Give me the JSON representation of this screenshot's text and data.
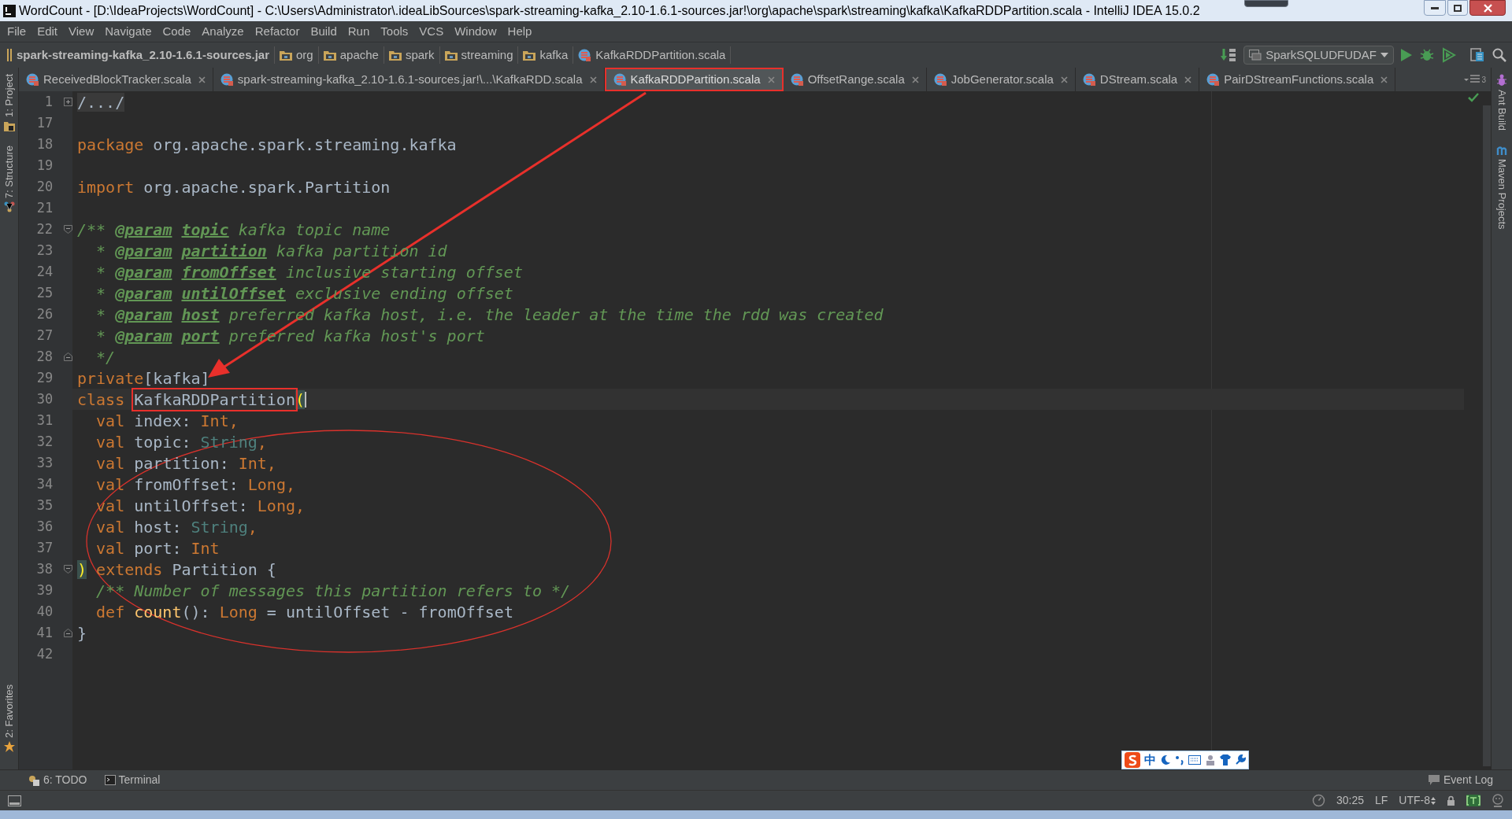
{
  "window": {
    "title": "WordCount - [D:\\IdeaProjects\\WordCount] - C:\\Users\\Administrator\\.ideaLibSources\\spark-streaming-kafka_2.10-1.6.1-sources.jar!\\org\\apache\\spark\\streaming\\kafka\\KafkaRDDPartition.scala - IntelliJ IDEA 15.0.2"
  },
  "menu": [
    "File",
    "Edit",
    "View",
    "Navigate",
    "Code",
    "Analyze",
    "Refactor",
    "Build",
    "Run",
    "Tools",
    "VCS",
    "Window",
    "Help"
  ],
  "breadcrumbs": [
    {
      "label": "spark-streaming-kafka_2.10-1.6.1-sources.jar",
      "kind": "jar"
    },
    {
      "label": "org",
      "kind": "folder"
    },
    {
      "label": "apache",
      "kind": "folder"
    },
    {
      "label": "spark",
      "kind": "folder"
    },
    {
      "label": "streaming",
      "kind": "folder"
    },
    {
      "label": "kafka",
      "kind": "folder"
    },
    {
      "label": "KafkaRDDPartition.scala",
      "kind": "file"
    }
  ],
  "run_config": "SparkSQLUDFUDAF",
  "tabs": [
    {
      "label": "ReceivedBlockTracker.scala",
      "selected": false,
      "highlighted": false
    },
    {
      "label": "spark-streaming-kafka_2.10-1.6.1-sources.jar!\\...\\KafkaRDD.scala",
      "selected": false,
      "highlighted": false
    },
    {
      "label": "KafkaRDDPartition.scala",
      "selected": true,
      "highlighted": true
    },
    {
      "label": "OffsetRange.scala",
      "selected": false,
      "highlighted": false
    },
    {
      "label": "JobGenerator.scala",
      "selected": false,
      "highlighted": false
    },
    {
      "label": "DStream.scala",
      "selected": false,
      "highlighted": false
    },
    {
      "label": "PairDStreamFunctions.scala",
      "selected": false,
      "highlighted": false
    }
  ],
  "tab_overflow": "3",
  "left_tool_windows_top": [
    "1: Project",
    "7: Structure"
  ],
  "left_tool_windows_bottom": [
    "2: Favorites"
  ],
  "right_tool_windows": [
    "Ant Build",
    "Maven Projects"
  ],
  "code_lines": [
    {
      "number": "1",
      "collapsed": true,
      "tokens": [
        {
          "kind": "folded",
          "text": "/.../"
        }
      ]
    },
    {
      "number": "17"
    },
    {
      "number": "18",
      "tokens": [
        {
          "kind": "keyword",
          "text": "package"
        },
        {
          "kind": "plain",
          "text": " org.apache.spark.streaming.kafka"
        }
      ]
    },
    {
      "number": "19"
    },
    {
      "number": "20",
      "tokens": [
        {
          "kind": "keyword",
          "text": "import"
        },
        {
          "kind": "plain",
          "text": " org.apache.spark.Partition"
        }
      ]
    },
    {
      "number": "21"
    },
    {
      "number": "22",
      "fold_start": true,
      "tokens": [
        {
          "kind": "doc",
          "text": "/** "
        },
        {
          "kind": "doc_tag",
          "text": "@param"
        },
        {
          "kind": "doc_param",
          "text": "topic"
        },
        {
          "kind": "doc",
          "text": " kafka topic name"
        }
      ]
    },
    {
      "number": "23",
      "tokens": [
        {
          "kind": "doc",
          "text": "  * "
        },
        {
          "kind": "doc_tag",
          "text": "@param"
        },
        {
          "kind": "doc_param",
          "text": "partition"
        },
        {
          "kind": "doc",
          "text": " kafka partition id"
        }
      ]
    },
    {
      "number": "24",
      "tokens": [
        {
          "kind": "doc",
          "text": "  * "
        },
        {
          "kind": "doc_tag",
          "text": "@param"
        },
        {
          "kind": "doc_param",
          "text": "fromOffset"
        },
        {
          "kind": "doc",
          "text": " inclusive starting offset"
        }
      ]
    },
    {
      "number": "25",
      "tokens": [
        {
          "kind": "doc",
          "text": "  * "
        },
        {
          "kind": "doc_tag",
          "text": "@param"
        },
        {
          "kind": "doc_param",
          "text": "untilOffset"
        },
        {
          "kind": "doc",
          "text": " exclusive ending offset"
        }
      ]
    },
    {
      "number": "26",
      "tokens": [
        {
          "kind": "doc",
          "text": "  * "
        },
        {
          "kind": "doc_tag",
          "text": "@param"
        },
        {
          "kind": "doc_param",
          "text": "host"
        },
        {
          "kind": "doc",
          "text": " preferred kafka host, i.e. the leader at the time the rdd was created"
        }
      ]
    },
    {
      "number": "27",
      "tokens": [
        {
          "kind": "doc",
          "text": "  * "
        },
        {
          "kind": "doc_tag",
          "text": "@param"
        },
        {
          "kind": "doc_param",
          "text": "port"
        },
        {
          "kind": "doc",
          "text": " preferred kafka host's port"
        }
      ]
    },
    {
      "number": "28",
      "fold_end": true,
      "tokens": [
        {
          "kind": "doc",
          "text": "  */"
        }
      ]
    },
    {
      "number": "29",
      "tokens": [
        {
          "kind": "keyword",
          "text": "private"
        },
        {
          "kind": "plain",
          "text": "[kafka]"
        }
      ]
    },
    {
      "number": "30",
      "current": true,
      "tokens": [
        {
          "kind": "keyword",
          "text": "class "
        },
        {
          "kind": "plain",
          "text": "KafkaRDDPartition",
          "highlighted": true
        },
        {
          "kind": "brace_match",
          "text": "("
        }
      ]
    },
    {
      "number": "31",
      "tokens": [
        {
          "kind": "keyword",
          "text": "  val"
        },
        {
          "kind": "plain",
          "text": " index: "
        },
        {
          "kind": "keyword",
          "text": "Int,"
        }
      ]
    },
    {
      "number": "32",
      "tokens": [
        {
          "kind": "keyword",
          "text": "  val"
        },
        {
          "kind": "plain",
          "text": " topic: "
        },
        {
          "kind": "type",
          "text": "String"
        },
        {
          "kind": "keyword",
          "text": ","
        }
      ]
    },
    {
      "number": "33",
      "tokens": [
        {
          "kind": "keyword",
          "text": "  val"
        },
        {
          "kind": "plain",
          "text": " partition: "
        },
        {
          "kind": "keyword",
          "text": "Int,"
        }
      ]
    },
    {
      "number": "34",
      "tokens": [
        {
          "kind": "keyword",
          "text": "  val"
        },
        {
          "kind": "plain",
          "text": " fromOffset: "
        },
        {
          "kind": "keyword",
          "text": "Long,"
        }
      ]
    },
    {
      "number": "35",
      "tokens": [
        {
          "kind": "keyword",
          "text": "  val"
        },
        {
          "kind": "plain",
          "text": " untilOffset: "
        },
        {
          "kind": "keyword",
          "text": "Long,"
        }
      ]
    },
    {
      "number": "36",
      "tokens": [
        {
          "kind": "keyword",
          "text": "  val"
        },
        {
          "kind": "plain",
          "text": " host: "
        },
        {
          "kind": "type",
          "text": "String"
        },
        {
          "kind": "keyword",
          "text": ","
        }
      ]
    },
    {
      "number": "37",
      "tokens": [
        {
          "kind": "keyword",
          "text": "  val"
        },
        {
          "kind": "plain",
          "text": " port: "
        },
        {
          "kind": "keyword",
          "text": "Int"
        }
      ]
    },
    {
      "number": "38",
      "fold_start": true,
      "tokens": [
        {
          "kind": "brace_match",
          "text": ")"
        },
        {
          "kind": "keyword",
          "text": " extends"
        },
        {
          "kind": "plain",
          "text": " Partition {"
        }
      ]
    },
    {
      "number": "39",
      "tokens": [
        {
          "kind": "comment",
          "text": "  /** Number of messages this partition refers to */"
        }
      ]
    },
    {
      "number": "40",
      "tokens": [
        {
          "kind": "keyword",
          "text": "  def "
        },
        {
          "kind": "function",
          "text": "count"
        },
        {
          "kind": "plain",
          "text": "(): "
        },
        {
          "kind": "keyword",
          "text": "Long"
        },
        {
          "kind": "plain",
          "text": " = untilOffset - fromOffset"
        }
      ]
    },
    {
      "number": "41",
      "fold_end": true,
      "tokens": [
        {
          "kind": "plain",
          "text": "}"
        }
      ]
    },
    {
      "number": "42"
    }
  ],
  "ime_bar": {
    "mode": "中"
  },
  "bottom_tool_windows": [
    {
      "label": "6: TODO",
      "kind": "todo"
    },
    {
      "label": "Terminal",
      "kind": "terminal"
    }
  ],
  "event_log": "Event Log",
  "status_bar": {
    "position": "30:25",
    "line_separator": "LF",
    "encoding": "UTF-8"
  }
}
